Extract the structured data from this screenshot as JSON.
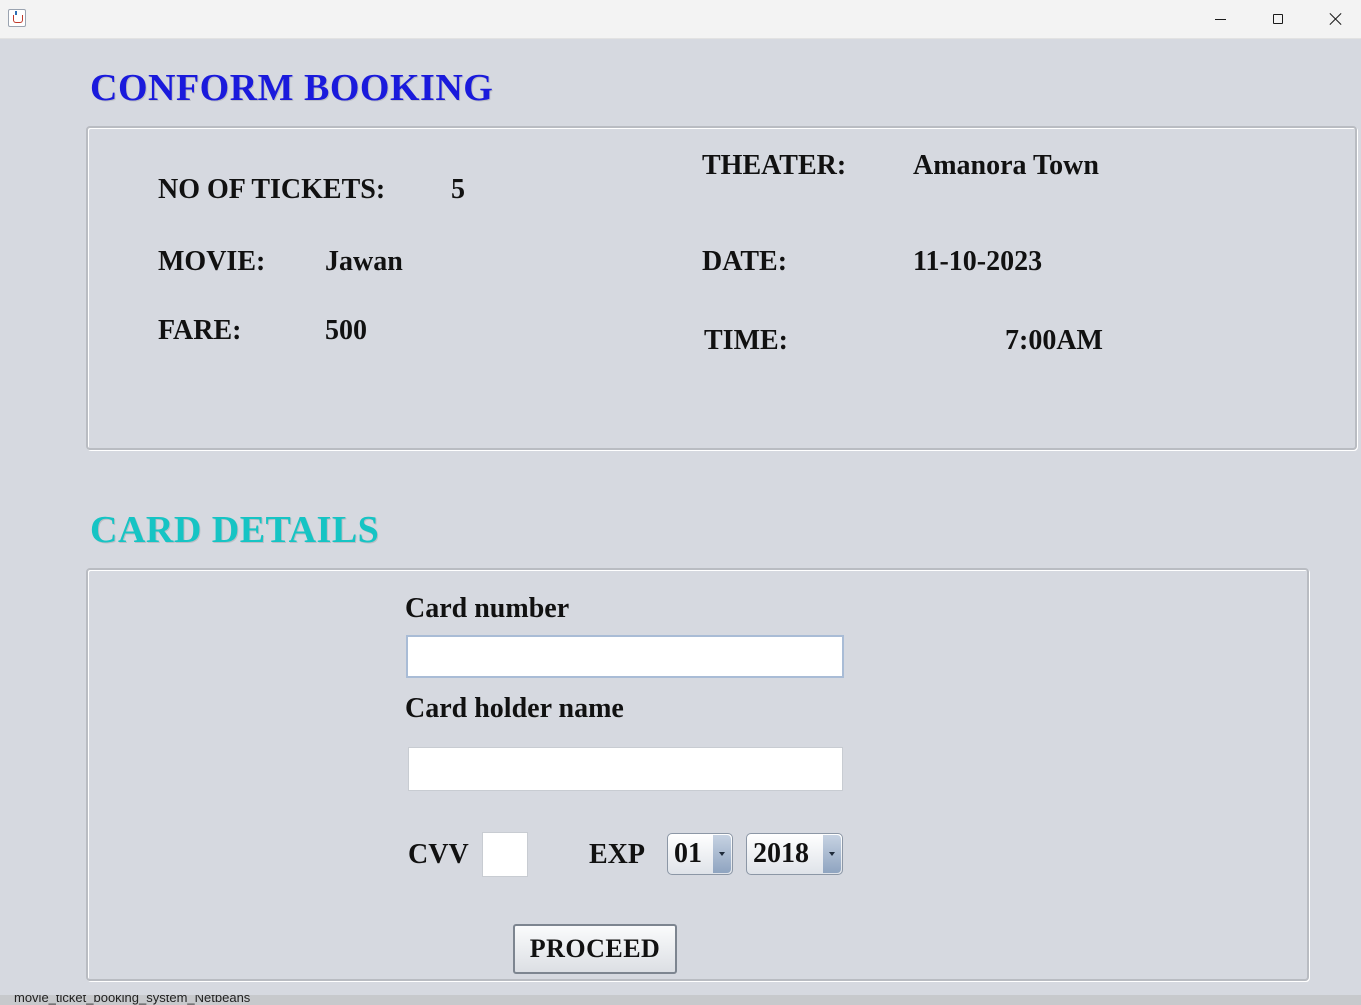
{
  "window": {
    "app_icon": "java-cup-icon",
    "controls": [
      "minimize-icon",
      "maximize-icon",
      "close-icon"
    ]
  },
  "booking": {
    "heading": "CONFORM BOOKING",
    "tickets_label": "NO OF TICKETS:",
    "tickets_value": "5",
    "movie_label": "MOVIE:",
    "movie_value": "Jawan",
    "fare_label": "FARE:",
    "fare_value": "500",
    "theater_label": "THEATER:",
    "theater_value": "Amanora Town",
    "date_label": "DATE:",
    "date_value": "11-10-2023",
    "time_label": "TIME:",
    "time_value": "7:00AM"
  },
  "card": {
    "heading": "CARD DETAILS",
    "number_label": "Card number",
    "number_value": "",
    "holder_label": "Card holder name",
    "holder_value": "",
    "cvv_label": "CVV",
    "cvv_value": "",
    "exp_label": "EXP",
    "exp_month": "01",
    "exp_year": "2018",
    "proceed_label": "PROCEED"
  },
  "taskbar": {
    "text": "movie_ticket_booking_system_Netbeans"
  },
  "colors": {
    "booking_heading": "#1a1adc",
    "card_heading": "#16c4c4",
    "background": "#d6d9e0"
  }
}
